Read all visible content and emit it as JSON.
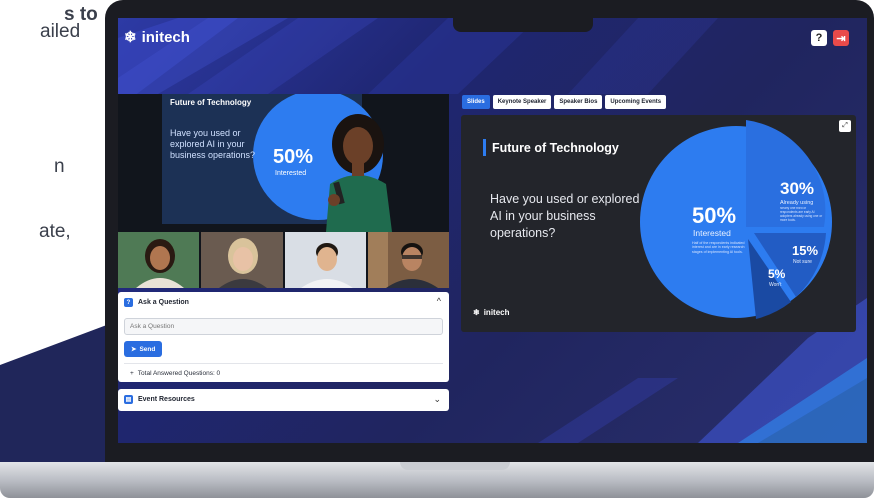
{
  "left_copy": {
    "line1": "s to",
    "line2": "ailed",
    "line3": "n",
    "line4": "ate,"
  },
  "brand": {
    "name": "initech",
    "icon": "snowflake-logo-icon"
  },
  "header": {
    "help_icon": "help-circle-icon",
    "help_glyph": "?",
    "logout_icon": "logout-icon",
    "logout_glyph": "⇥"
  },
  "video": {
    "slide_title": "Future of Technology",
    "slide_question": "Have you used or explored AI in your business operations?",
    "big_percent": "50%",
    "big_label": "Interested"
  },
  "ask_panel": {
    "title": "Ask a Question",
    "placeholder": "Ask a Question",
    "send_label": "Send",
    "total_label": "Total Answered Questions: 0",
    "chevron": "^"
  },
  "resources_panel": {
    "title": "Event Resources",
    "chevron": "⌄"
  },
  "tabs": [
    {
      "label": "Slides",
      "active": true
    },
    {
      "label": "Keynote Speaker",
      "active": false
    },
    {
      "label": "Speaker Bios",
      "active": false
    },
    {
      "label": "Upcoming Events",
      "active": false
    }
  ],
  "slide": {
    "title": "Future of Technology",
    "question": "Have you used or explored AI in your business operations?",
    "logo_text": "initech",
    "expand_icon": "expand-icon",
    "expand_glyph": "⤢"
  },
  "pie": {
    "segments": [
      {
        "percent": "50%",
        "label": "Interested",
        "note": "Half of the respondents indicated interest and are in early research stages of implementing AI tools.",
        "color": "#2d7cf0"
      },
      {
        "percent": "30%",
        "label": "Already using",
        "note": "Nearly one third of respondents are early AI adopters already using one or more tools.",
        "color": "#2a6fe0"
      },
      {
        "percent": "15%",
        "label": "Not sure",
        "note": "",
        "color": "#225cc4"
      },
      {
        "percent": "5%",
        "label": "Won't",
        "note": "",
        "color": "#1a4aa3"
      }
    ]
  },
  "colors": {
    "accent": "#2a6de0",
    "logout": "#e94a4a",
    "background": "#20255f"
  }
}
